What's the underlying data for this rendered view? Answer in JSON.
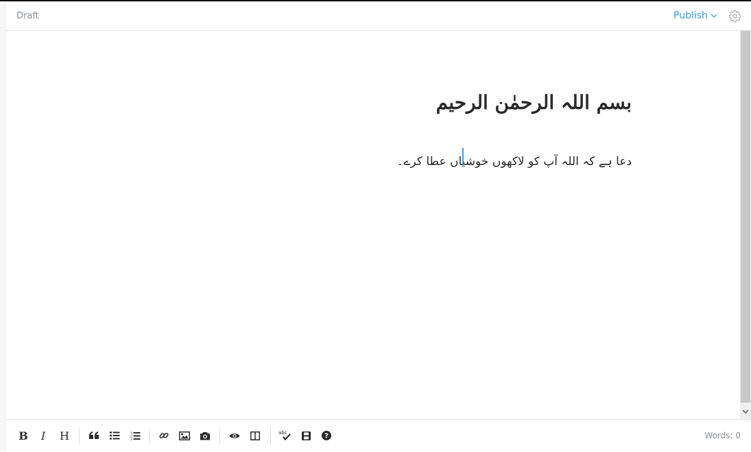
{
  "header": {
    "status": "Draft",
    "publish_label": "Publish"
  },
  "editor": {
    "heading": "بسم اللہ الرحمٰن الرحیم",
    "paragraph": "دعا ہے کہ اللہ آپ کو لاکھوں خوشیاں عطا کرے۔"
  },
  "toolbar": {
    "icons": [
      "bold-icon",
      "italic-icon",
      "heading-icon",
      "quote-icon",
      "unordered-list-icon",
      "ordered-list-icon",
      "link-icon",
      "image-icon",
      "camera-icon",
      "preview-icon",
      "side-by-side-icon",
      "spellcheck-icon",
      "save-icon",
      "help-icon"
    ],
    "bold_label": "B",
    "italic_label": "I",
    "heading_label": "H",
    "words_label": "Words:",
    "words_count": "0"
  },
  "colors": {
    "accent": "#3a9fd8",
    "text": "#2a2a2a",
    "muted": "#8a8f95"
  }
}
